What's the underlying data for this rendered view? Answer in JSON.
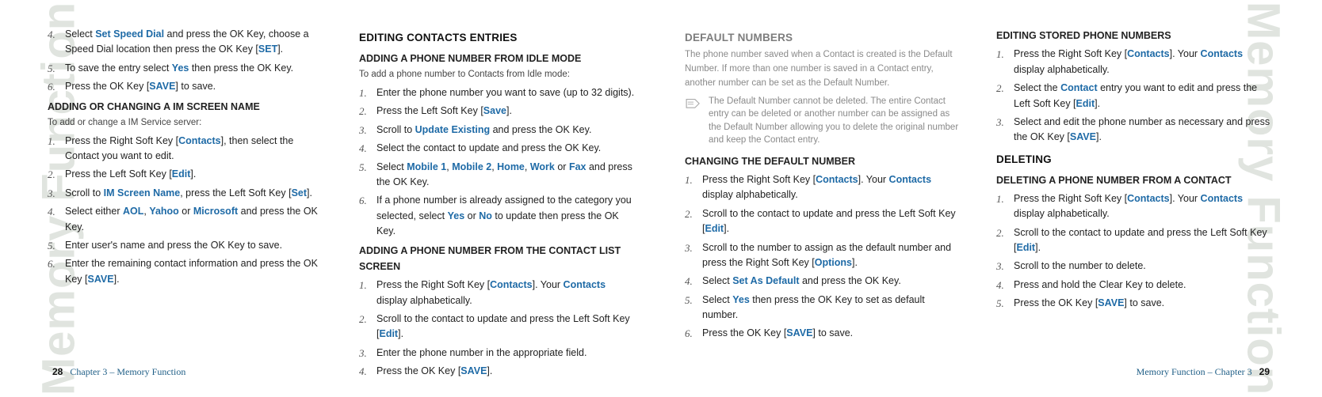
{
  "decor": {
    "sideText": "Memory Function"
  },
  "footer": {
    "leftPage": "28",
    "leftLabel": "Chapter 3 – Memory Function",
    "rightLabel": "Memory Function – Chapter 3",
    "rightPage": "29"
  },
  "left": {
    "col1": {
      "list1": [
        {
          "pre": "Select ",
          "b1": "Set Speed Dial",
          "mid": " and press the OK Key, choose a Speed Dial location then press the OK Key [",
          "b2": "SET",
          "post": "]."
        },
        {
          "pre": "To save the entry select ",
          "b1": "Yes",
          "post": " then press the OK Key."
        },
        {
          "pre": "Press the OK Key [",
          "b1": "SAVE",
          "post": "] to save."
        }
      ],
      "h2a": "ADDING OR CHANGING A IM SCREEN NAME",
      "introA": "To add or change a IM Service server:",
      "list2": [
        {
          "pre": "Press the Right Soft Key [",
          "b1": "Contacts",
          "post": "], then select the Contact you want to edit."
        },
        {
          "pre": "Press the Left Soft Key [",
          "b1": "Edit",
          "post": "]."
        },
        {
          "pre": "Scroll to ",
          "b1": "IM Screen Name",
          "mid": ", press the Left Soft Key [",
          "b2": "Set",
          "post": "]."
        },
        {
          "pre": "Select either ",
          "b1": "AOL",
          "mid1": ", ",
          "b2": "Yahoo",
          "mid2": " or ",
          "b3": "Microsoft",
          "post": " and press the OK Key."
        },
        {
          "pre": "Enter user's name and press the OK Key to save."
        },
        {
          "pre": "Enter the remaining contact information and press the OK Key [",
          "b1": "SAVE",
          "post": "]."
        }
      ]
    },
    "col2": {
      "h1": "EDITING CONTACTS ENTRIES",
      "h2a": "ADDING A PHONE NUMBER FROM IDLE MODE",
      "introA": "To add a phone number to Contacts from Idle mode:",
      "list1": [
        {
          "pre": "Enter the phone number you want to save (up to 32 digits)."
        },
        {
          "pre": "Press the Left Soft Key [",
          "b1": "Save",
          "post": "]."
        },
        {
          "pre": "Scroll to ",
          "b1": "Update Existing",
          "post": " and press the OK Key."
        },
        {
          "pre": "Select the contact to update and press the OK Key."
        },
        {
          "pre": "Select ",
          "b1": "Mobile 1",
          "mid1": ", ",
          "b2": "Mobile 2",
          "mid2": ", ",
          "b3": "Home",
          "mid3": ", ",
          "b4": "Work",
          "mid4": " or ",
          "b5": "Fax",
          "post": " and press the OK Key."
        },
        {
          "pre": "If a phone number is already assigned to the category you selected, select ",
          "b1": "Yes",
          "mid": " or ",
          "b2": "No",
          "post": " to update then press the OK Key."
        }
      ],
      "h2b": "ADDING A PHONE NUMBER FROM THE CONTACT LIST SCREEN",
      "list2": [
        {
          "pre": "Press the Right Soft Key [",
          "b1": "Contacts",
          "mid": "]. Your ",
          "b2": "Contacts",
          "post": " display alphabetically."
        },
        {
          "pre": "Scroll to the contact to update and press the Left Soft Key [",
          "b1": "Edit",
          "post": "]."
        },
        {
          "pre": "Enter the phone number in the appropriate field."
        },
        {
          "pre": "Press the OK Key [",
          "b1": "SAVE",
          "post": "]."
        }
      ]
    }
  },
  "right": {
    "col1": {
      "h1": "DEFAULT NUMBERS",
      "introA": "The phone number saved when a Contact is created is the Default Number. If more than one number is saved in a Contact entry, another number can be set as the Default Number.",
      "note": "The Default Number cannot be deleted. The entire Contact entry can be deleted or another number can be assigned as the Default Number allowing you to delete the original number and keep the Contact entry.",
      "h2a": "CHANGING THE DEFAULT NUMBER",
      "list1": [
        {
          "pre": "Press the Right Soft Key [",
          "b1": "Contacts",
          "mid": "]. Your ",
          "b2": "Contacts",
          "post": " display alphabetically."
        },
        {
          "pre": "Scroll to the contact to update and press the Left Soft Key [",
          "b1": "Edit",
          "post": "]."
        },
        {
          "pre": "Scroll to the number to assign as the default number and press the Right Soft Key [",
          "b1": "Options",
          "post": "]."
        },
        {
          "pre": "Select ",
          "b1": "Set As Default",
          "post": " and press the OK Key."
        },
        {
          "pre": "Select ",
          "b1": "Yes",
          "post": " then press the OK Key to set as default number."
        },
        {
          "pre": "Press the OK Key [",
          "b1": "SAVE",
          "post": "] to save."
        }
      ]
    },
    "col2": {
      "h2a": "EDITING STORED PHONE NUMBERS",
      "list1": [
        {
          "pre": "Press the Right Soft Key [",
          "b1": "Contacts",
          "mid": "]. Your ",
          "b2": "Contacts",
          "post": " display alphabetically."
        },
        {
          "pre": "Select the ",
          "b1": "Contact",
          "mid": " entry you want to edit and press the Left Soft Key [",
          "b2": "Edit",
          "post": "]."
        },
        {
          "pre": "Select and edit the phone number as necessary and press the OK Key [",
          "b1": "SAVE",
          "post": "]."
        }
      ],
      "h1": "DELETING",
      "h2b": "DELETING A PHONE NUMBER FROM A CONTACT",
      "list2": [
        {
          "pre": "Press the Right Soft Key [",
          "b1": "Contacts",
          "mid": "]. Your ",
          "b2": "Contacts",
          "post": " display alphabetically."
        },
        {
          "pre": "Scroll to the contact to update and press the Left Soft Key [",
          "b1": "Edit",
          "post": "]."
        },
        {
          "pre": "Scroll to the number to delete."
        },
        {
          "pre": "Press and hold the Clear Key to delete."
        },
        {
          "pre": "Press the OK Key [",
          "b1": "SAVE",
          "post": "] to save."
        }
      ]
    }
  }
}
